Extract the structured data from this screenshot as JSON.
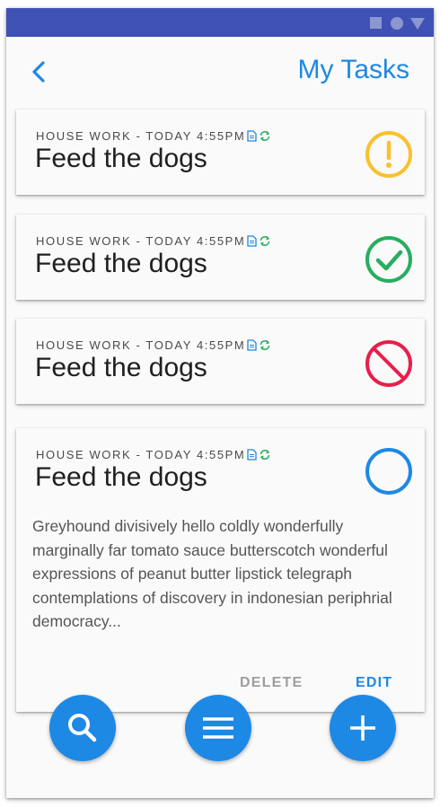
{
  "header": {
    "title": "My Tasks",
    "back_icon": "chevron-left-icon"
  },
  "colors": {
    "status_bar": "#3f51b5",
    "accent": "#1e88e5",
    "warning": "#fbc02d",
    "done": "#27ae60",
    "blocked": "#e91e4b"
  },
  "tasks": [
    {
      "meta": "HOUSE WORK - TODAY 4:55PM",
      "title": "Feed the dogs",
      "status": "warning"
    },
    {
      "meta": "HOUSE WORK - TODAY 4:55PM",
      "title": "Feed the dogs",
      "status": "done"
    },
    {
      "meta": "HOUSE WORK - TODAY 4:55PM",
      "title": "Feed the dogs",
      "status": "blocked"
    },
    {
      "meta": "HOUSE WORK - TODAY 4:55PM",
      "title": "Feed the dogs",
      "status": "open",
      "description": "Greyhound divisively hello coldly wonderfully marginally far tomato sauce butterscotch wonderful expressions of peanut butter lipstick telegraph contemplations of discovery in indonesian periphrial democracy...",
      "delete_label": "DELETE",
      "edit_label": "EDIT"
    }
  ],
  "fabs": {
    "search_icon": "search-icon",
    "menu_icon": "menu-icon",
    "add_icon": "plus-icon"
  }
}
